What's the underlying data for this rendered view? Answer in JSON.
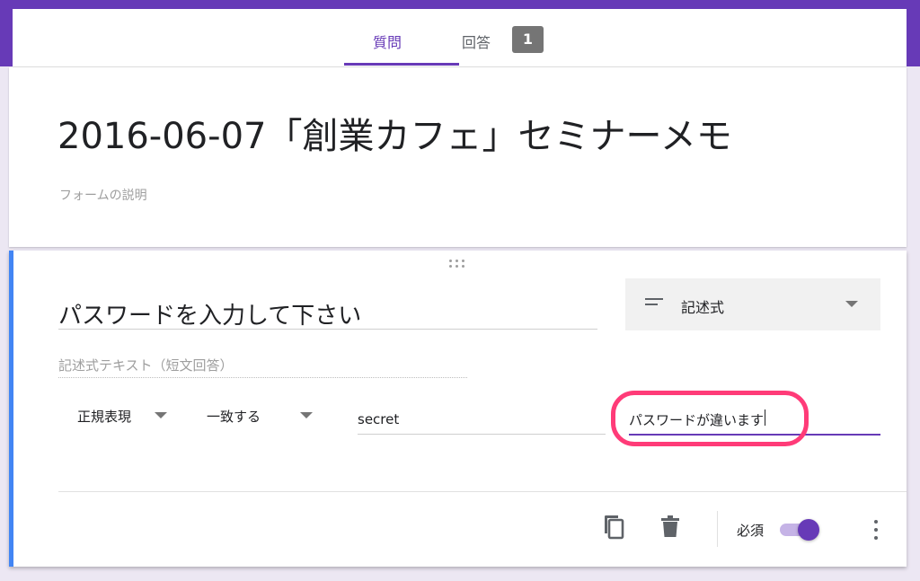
{
  "tabs": {
    "questions_label": "質問",
    "responses_label": "回答",
    "responses_count": "1"
  },
  "form": {
    "title": "2016-06-07「創業カフェ」セミナーメモ",
    "description_placeholder": "フォームの説明"
  },
  "question": {
    "title": "パスワードを入力して下さい",
    "type_label": "記述式",
    "answer_placeholder": "記述式テキスト（短文回答）",
    "validation": {
      "type": "正規表現",
      "operator": "一致する",
      "pattern": "secret",
      "error_text": "パスワードが違います"
    },
    "required_label": "必須",
    "required": true
  },
  "colors": {
    "accent": "#673ab7",
    "highlight": "#ff3b78",
    "active_border": "#4285f4"
  }
}
